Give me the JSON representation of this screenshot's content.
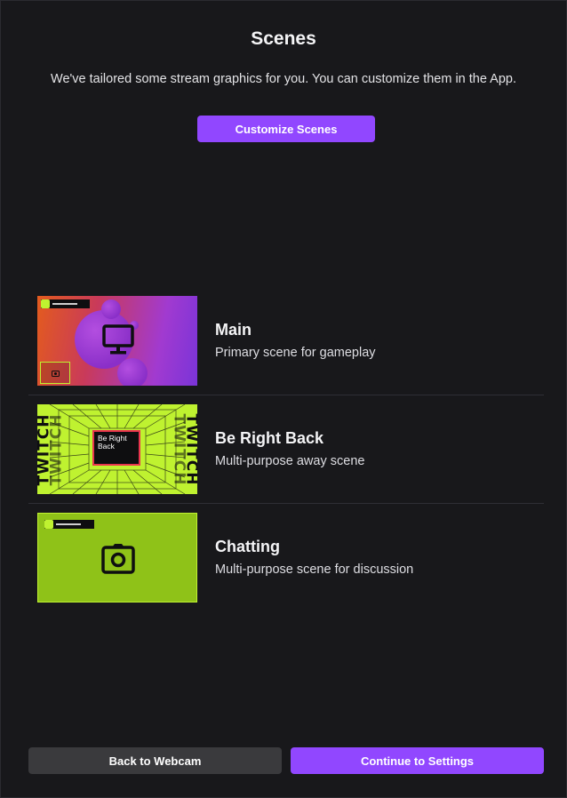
{
  "header": {
    "title": "Scenes",
    "subtitle": "We've tailored some stream graphics for you. You can customize them in the App.",
    "customize_label": "Customize Scenes"
  },
  "scenes": [
    {
      "name": "Main",
      "description": "Primary scene for gameplay",
      "thumbnail_icon": "monitor-icon"
    },
    {
      "name": "Be Right Back",
      "description": "Multi-purpose away scene",
      "thumbnail_icon": "twitch-wordmark",
      "thumbnail_text": "TWITCH",
      "card_text": "Be Right Back"
    },
    {
      "name": "Chatting",
      "description": "Multi-purpose scene for discussion",
      "thumbnail_icon": "camera-icon"
    }
  ],
  "footer": {
    "back_label": "Back to Webcam",
    "continue_label": "Continue to Settings"
  },
  "colors": {
    "background": "#18181b",
    "primary_button": "#9147ff",
    "secondary_button": "#3a3a3d",
    "accent_green": "#bff230"
  }
}
